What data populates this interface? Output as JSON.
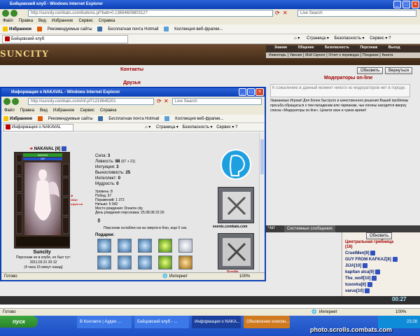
{
  "main_window": {
    "title": "Бойцовский клуб - Windows Internet Explorer",
    "url": "http://suncity.combats.com/buttons.pl?batt=0.1369460980312?",
    "search_placeholder": "Live Search",
    "menu": [
      "Файл",
      "Правка",
      "Вид",
      "Избранное",
      "Сервис",
      "Справка"
    ],
    "favorites_label": "Избранное",
    "fav_links": [
      "Рекомендуемые сайты",
      "Бесплатная почта Hotmail",
      "Коллекция веб-фрагме..."
    ],
    "tab_title": "Бойцовский клуб",
    "toolbar_right": [
      "Страница",
      "Безопасность",
      "Сервис"
    ],
    "status_left": "Готово",
    "status_zone": "Интернет",
    "zoom": "100%"
  },
  "game": {
    "logo": "SUNCITY",
    "nav_top": [
      "Знания",
      "Общение",
      "Безопасность",
      "Персонаж",
      "Выход"
    ],
    "nav_sub": [
      "Инвентарь",
      "Умения",
      "Мой Скролл",
      "Отчет о переводах",
      "Поединки",
      "Анкета"
    ],
    "links": [
      "Контакты",
      "Друзья"
    ],
    "refresh_button": "Обновить",
    "back_button": "Вернуться",
    "moderators_title": "Модераторы on-line",
    "moderators_empty": "К сожалению в данный момент никого из модераторов нет в городе.",
    "notice": "Уважаемые Игроки! Для более быстрого и качественного решения Вашей проблемы просьба обращаться к тем паладинам или тарманам, чьи логины находятся вверху списка «Модераторы on-line». Ценити свое и чужое время!",
    "chat_tabs": [
      "Чат",
      "Системные сообщения"
    ],
    "room_refresh": "Обновить",
    "room_title": "Центральная грибница",
    "room_count": "(16)",
    "players": [
      "CruelMen[9]",
      "GUY FROM KAFKAZ[8]",
      "JIJA[10]",
      "kapitan alca[9]",
      "The_wolf[10]",
      "tusovka[8]",
      "varus[10]"
    ],
    "clock": "00:27"
  },
  "popup": {
    "title": "Информация о NAKAVAL - Windows Internet Explorer",
    "url": "http://suncity.combats.com/inf.pl?1219645201",
    "search_placeholder": "Live Search",
    "menu": [
      "Файл",
      "Правка",
      "Вид",
      "Избранное",
      "Сервис",
      "Справка"
    ],
    "favorites_label": "Избранное",
    "fav_links": [
      "Рекомендуемые сайты",
      "Бесплатная почта Hotmail",
      "Коллекция веб-фрагме..."
    ],
    "tab_title": "Информация о NAKAVAL",
    "toolbar_right": [
      "Страница",
      "Безопасность",
      "Сервис"
    ],
    "status_left": "Готово",
    "status_zone": "Интернет",
    "zoom": "100%",
    "char_name": "NAKAVAL",
    "char_level": "[8]",
    "hp_bar": "943/943",
    "mana_bar": "0/0",
    "offline_label": "Обит огрен по",
    "city": "Suncity",
    "offline_text": "Персонаж не в клубе, но был тут:",
    "last_seen": "2011.03.31 20:12",
    "ago": "(4 часа 15 минут назад)",
    "stats": [
      {
        "label": "Сила:",
        "value": "3"
      },
      {
        "label": "Ловкость:",
        "value": "88",
        "extra": "(67 + 21)"
      },
      {
        "label": "Интуиция:",
        "value": "3"
      },
      {
        "label": "Выносливость:",
        "value": "25"
      },
      {
        "label": "Интеллект:",
        "value": "0"
      },
      {
        "label": "Мудрость:",
        "value": "0"
      }
    ],
    "info_lines": [
      "Уровень: 8",
      "Побед: 37",
      "Поражений: 1 372",
      "Ничьих: 5 042",
      "Место рождения: Dreams city",
      "День рождения персонажа: 25.08.08 22:20"
    ],
    "weakened": "Персонаж ослаблен из-за смерти в бою, еще 0 сек.",
    "gifts_label": "Подарки:",
    "banner_site": "events.combats.com",
    "scrolls_label": "Scrolls"
  },
  "taskbar": {
    "start": "пуск",
    "items": [
      "В Контакте | Аудио ...",
      "Бойцовский клуб - ...",
      "Информация о NAKA...",
      "Обновление компон..."
    ],
    "clock": "23:28"
  },
  "watermark": "photo.scrolls.combats.com"
}
